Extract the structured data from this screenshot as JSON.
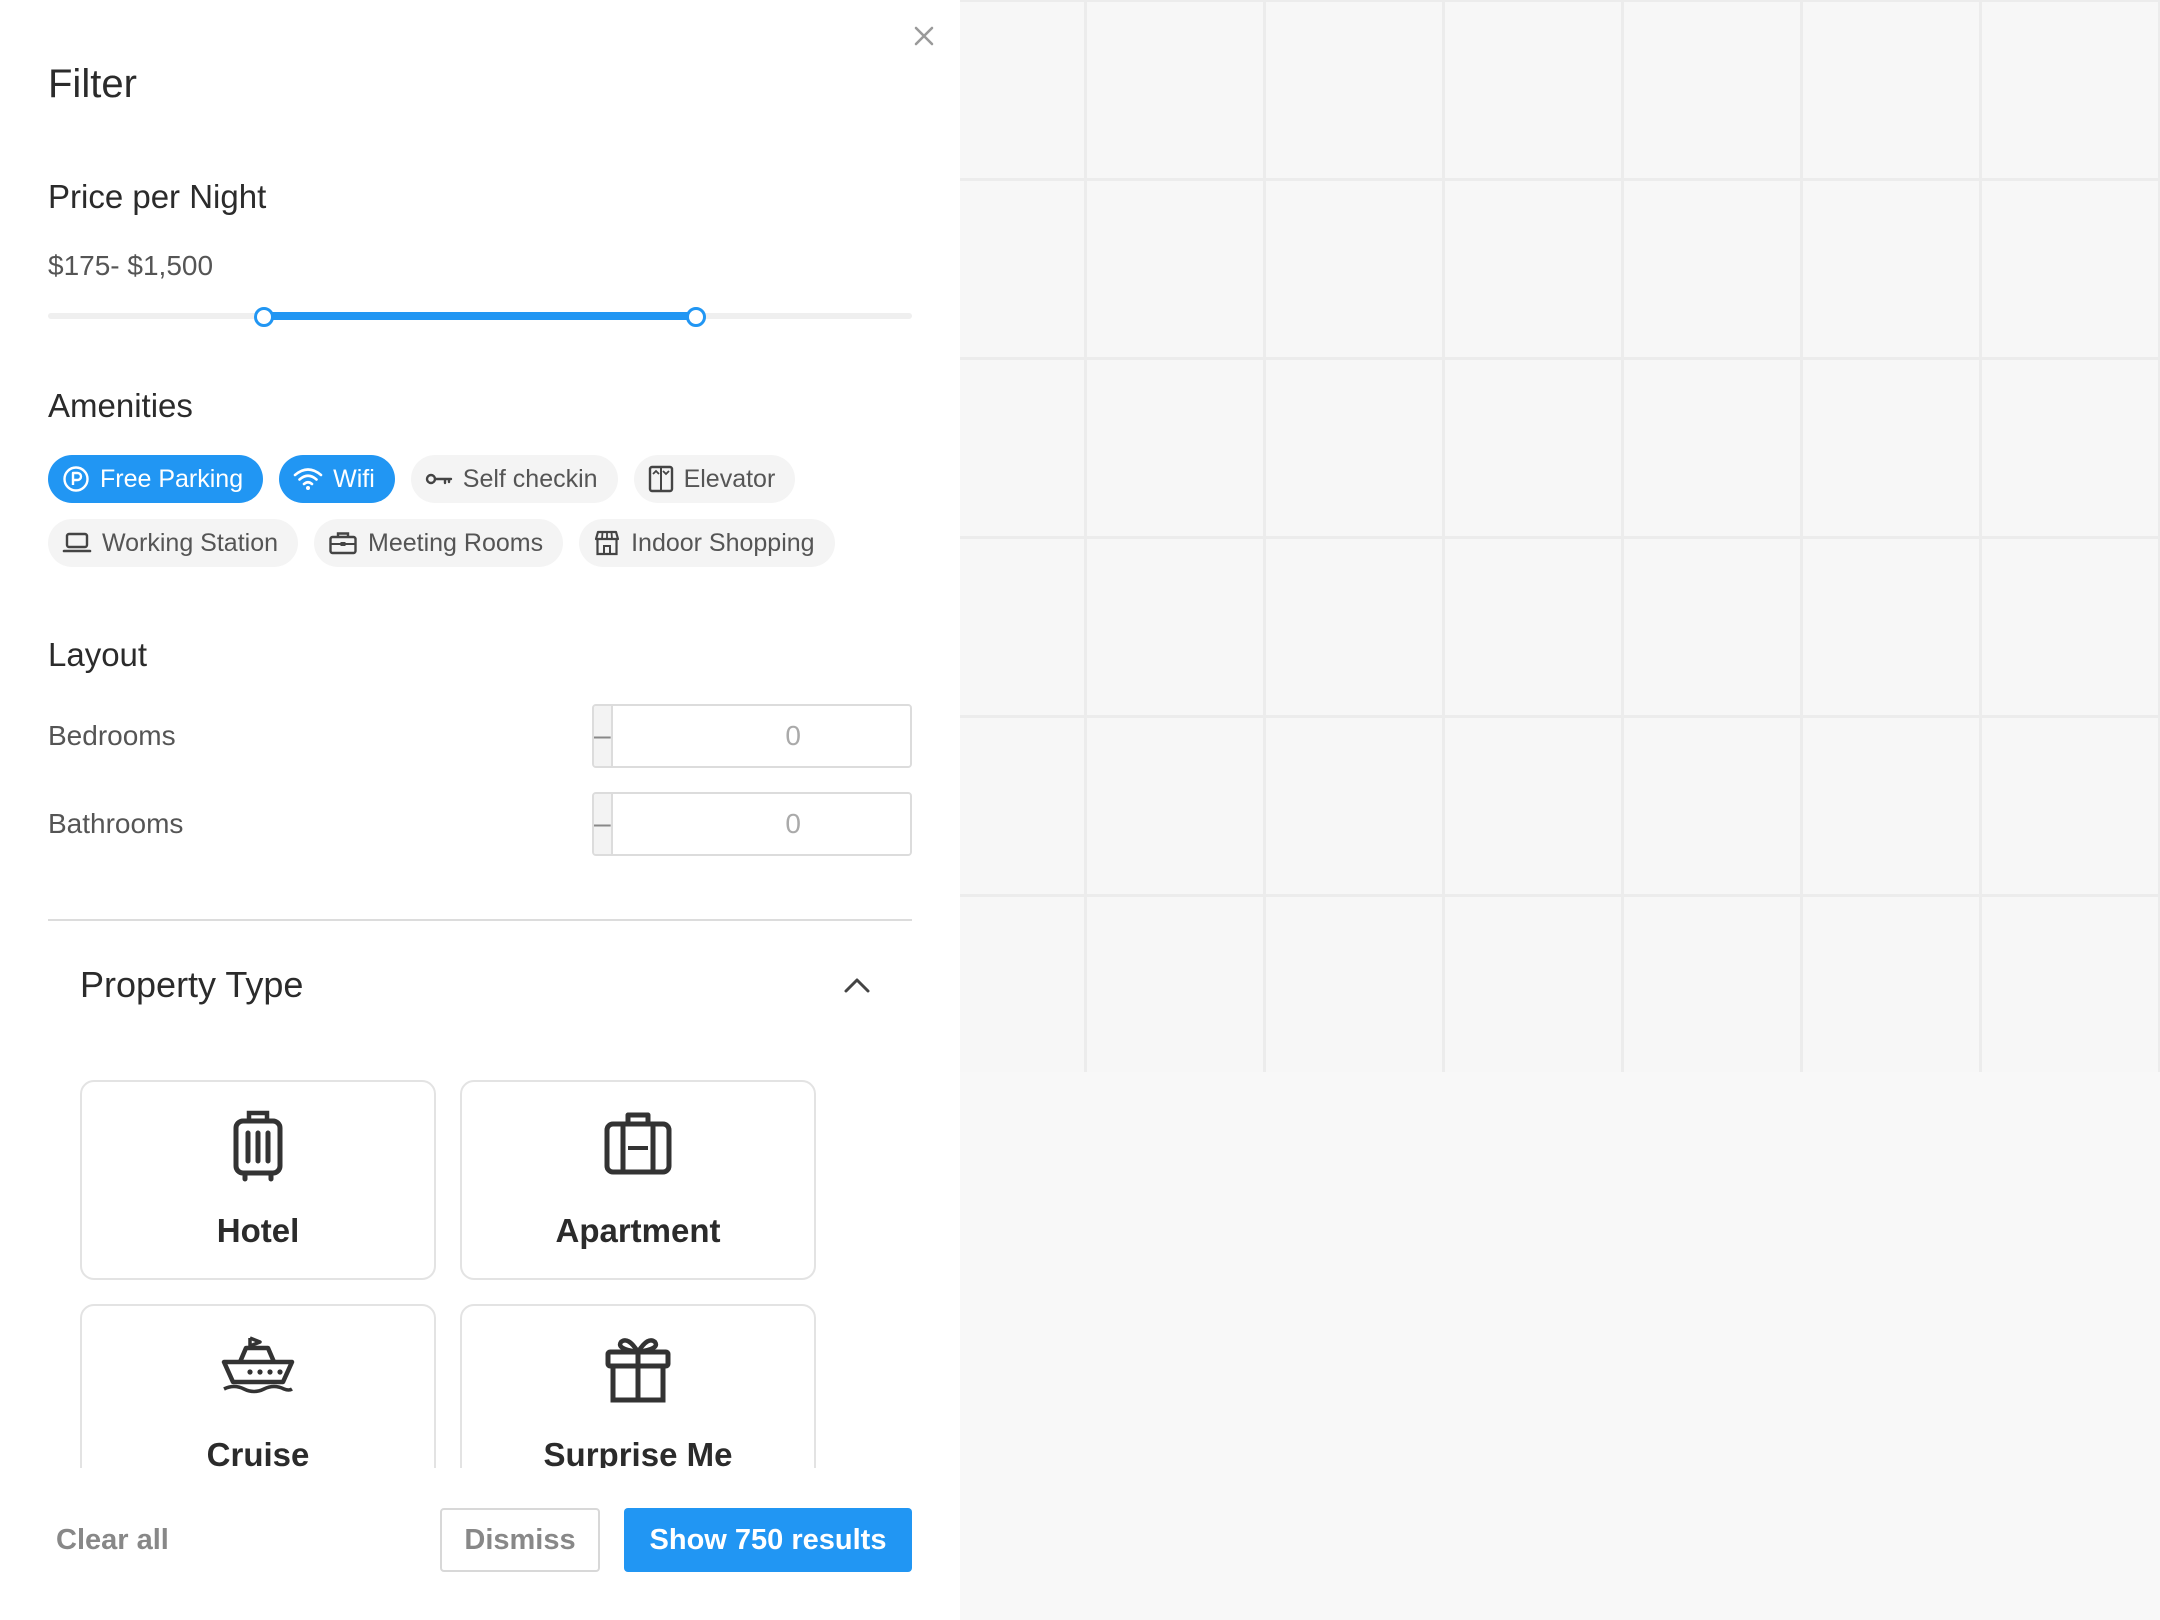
{
  "panel": {
    "title": "Filter",
    "close_icon": "close-icon"
  },
  "price": {
    "title": "Price per Night",
    "range_text": "$175- $1,500",
    "slider_low_fraction": 0.25,
    "slider_high_fraction": 0.75,
    "accent_color": "#2196f3"
  },
  "amenities": {
    "title": "Amenities",
    "items": [
      {
        "label": "Free Parking",
        "icon": "parking-icon",
        "active": true
      },
      {
        "label": "Wifi",
        "icon": "wifi-icon",
        "active": true
      },
      {
        "label": "Self checkin",
        "icon": "key-icon",
        "active": false
      },
      {
        "label": "Elevator",
        "icon": "elevator-icon",
        "active": false
      },
      {
        "label": "Working Station",
        "icon": "laptop-icon",
        "active": false
      },
      {
        "label": "Meeting Rooms",
        "icon": "briefcase-icon",
        "active": false
      },
      {
        "label": "Indoor Shopping",
        "icon": "store-icon",
        "active": false
      }
    ]
  },
  "layout": {
    "title": "Layout",
    "bedrooms": {
      "label": "Bedrooms",
      "value": "0",
      "minus": "–",
      "plus": "+"
    },
    "bathrooms": {
      "label": "Bathrooms",
      "value": "0",
      "minus": "–",
      "plus": "+"
    }
  },
  "property_type": {
    "title": "Property Type",
    "chevron_icon": "chevron-up-icon",
    "items": [
      {
        "label": "Hotel",
        "icon": "luggage-icon"
      },
      {
        "label": "Apartment",
        "icon": "suitcase-icon"
      },
      {
        "label": "Cruise",
        "icon": "ship-icon"
      },
      {
        "label": "Surprise Me",
        "icon": "gift-icon"
      }
    ]
  },
  "footer": {
    "clear_all": "Clear all",
    "dismiss": "Dismiss",
    "show_results": "Show 750 results"
  }
}
